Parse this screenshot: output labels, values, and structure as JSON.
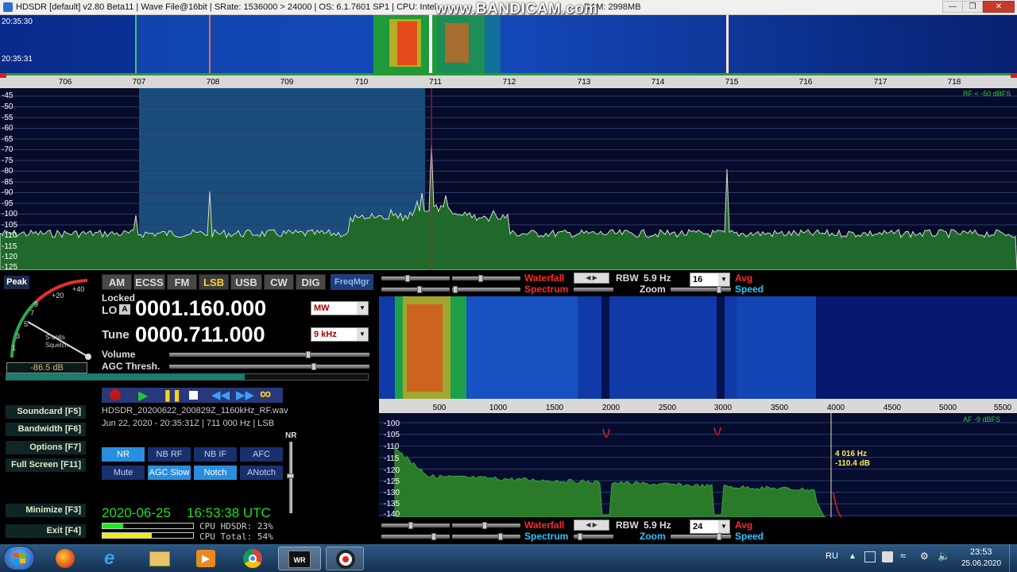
{
  "window": {
    "title": "HDSDR  [default]  v2.80 Beta11  |  Wave File@16bit  |  SRate: 1536000 > 24000  |  OS: 6.1.7601 SP1  |  CPU: Intel",
    "title_tail": "RAM: 2998MB",
    "watermark": "www.BANDICAM.com",
    "controls": [
      "minimize",
      "maximize",
      "close"
    ]
  },
  "top_waterfall": {
    "timestamps": [
      "20:35:30",
      "20:35:31"
    ]
  },
  "freq_ruler": {
    "labels": [
      "706",
      "707",
      "708",
      "709",
      "710",
      "711",
      "712",
      "713",
      "714",
      "715",
      "716",
      "717",
      "718"
    ]
  },
  "rf_spectrum": {
    "db_labels": [
      "-45",
      "-50",
      "-55",
      "-60",
      "-65",
      "-70",
      "-75",
      "-80",
      "-85",
      "-90",
      "-95",
      "-100",
      "-105",
      "-110",
      "-115",
      "-120",
      "-125"
    ],
    "level_note": "RF < -50 dBFS"
  },
  "smeter": {
    "peak_label": "Peak",
    "scale": [
      "+40",
      "+20",
      "9",
      "7",
      "5",
      "3",
      "1"
    ],
    "caption1": "S-units",
    "caption2": "Squelch",
    "reading": "-86.5 dB"
  },
  "modes": [
    "AM",
    "ECSS",
    "FM",
    "LSB",
    "USB",
    "CW",
    "DIG"
  ],
  "selected_mode": "LSB",
  "freqmgr_label": "FreqMgr",
  "lo": {
    "locked_label": "Locked",
    "label": "LO",
    "sub": "A",
    "value": "0001.160.000",
    "band": "MW"
  },
  "tune": {
    "label": "Tune",
    "value": "0000.711.000",
    "step": "9 kHz"
  },
  "volume_label": "Volume",
  "agc_label": "AGC Thresh.",
  "function_keys": [
    "Soundcard  [F5]",
    "Bandwidth  [F6]",
    "Options  [F7]",
    "Full Screen  [F11]",
    "Minimize  [F3]",
    "Exit  [F4]"
  ],
  "file": {
    "name": "HDSDR_20200622_200829Z_1160kHz_RF.wav",
    "info": "Jun 22, 2020 - 20:35:31Z | 711 000 Hz | LSB"
  },
  "dsp_buttons": [
    {
      "label": "NR",
      "on": true
    },
    {
      "label": "NB RF",
      "on": false
    },
    {
      "label": "NB IF",
      "on": false
    },
    {
      "label": "AFC",
      "on": false
    },
    {
      "label": "Mute",
      "on": false
    },
    {
      "label": "AGC Slow",
      "on": true
    },
    {
      "label": "Notch",
      "on": true
    },
    {
      "label": "ANotch",
      "on": false
    }
  ],
  "nr_slider_label": "NR",
  "clock": {
    "date": "2020-06-25",
    "time": "16:53:38 UTC"
  },
  "cpu": {
    "hdsdr": "CPU HDSDR: 23%",
    "total": "CPU Total: 54%",
    "hdsdr_pct": 23,
    "total_pct": 54
  },
  "top_right_controls": {
    "waterfall": "Waterfall",
    "spectrum": "Spectrum",
    "rbw_label": "RBW",
    "rbw_value": "5.9 Hz",
    "avg_value": "16",
    "avg_label": "Avg",
    "zoom_label": "Zoom",
    "speed_label": "Speed"
  },
  "bottom_right_controls": {
    "waterfall": "Waterfall",
    "spectrum": "Spectrum",
    "rbw_label": "RBW",
    "rbw_value": "5.9 Hz",
    "avg_value": "24",
    "avg_label": "Avg",
    "zoom_label": "Zoom",
    "speed_label": "Speed"
  },
  "af_ruler": {
    "labels": [
      "500",
      "1000",
      "1500",
      "2000",
      "2500",
      "3000",
      "3500",
      "4000",
      "4500",
      "5000",
      "5500"
    ]
  },
  "af_spectrum": {
    "db_labels": [
      "-100",
      "-105",
      "-110",
      "-115",
      "-120",
      "-125",
      "-130",
      "-135",
      "-140"
    ],
    "level_note": "AF  -9 dBFS",
    "cursor_freq": "4 016 Hz",
    "cursor_db": "-110.4 dB"
  },
  "taskbar": {
    "apps": [
      "start",
      "firefox",
      "internet-explorer",
      "file-explorer",
      "media-player",
      "chrome",
      "winrad-hdsdr",
      "bandicam"
    ],
    "lang": "RU",
    "time": "23:53",
    "date": "25.06.2020"
  },
  "colors": {
    "spectrum_fill": "#1f6a2a",
    "passband": "#1d5a8a",
    "mode_selected": "#ffcc33",
    "freq_digits": "#ffffff",
    "clock_green": "#22dd22"
  }
}
